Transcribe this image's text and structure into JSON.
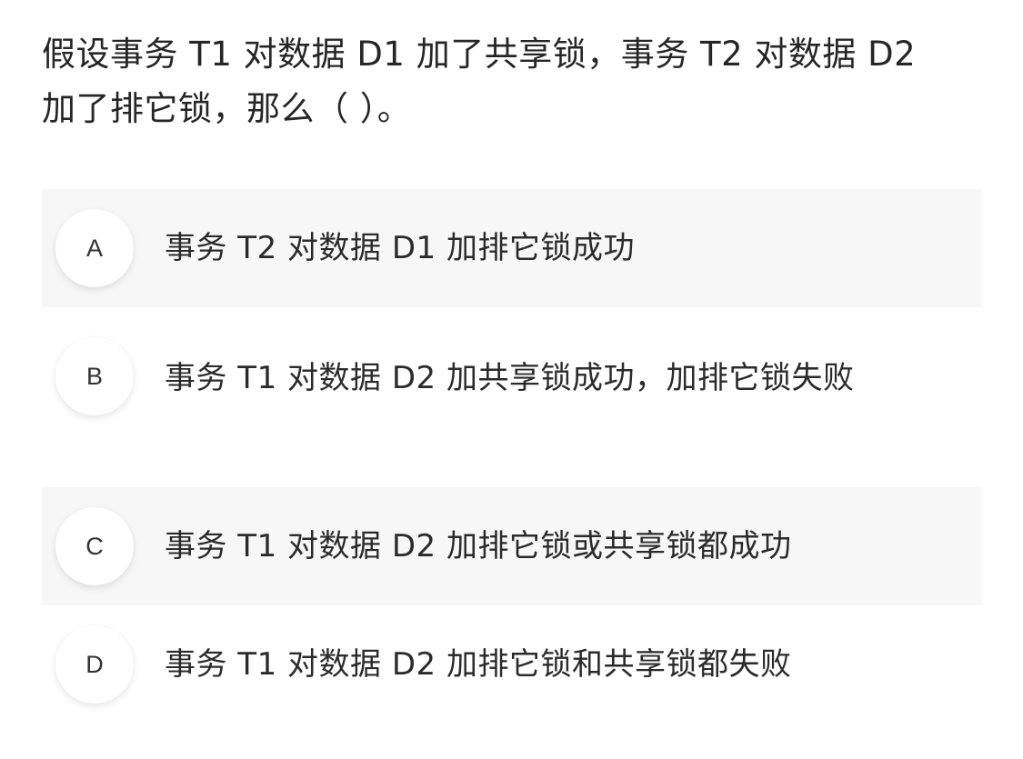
{
  "question": {
    "text": "假设事务 T1 对数据 D1 加了共享锁，事务 T2 对数据 D2 加了排它锁，那么（ ）。"
  },
  "options": [
    {
      "letter": "A",
      "text": "事务 T2 对数据 D1 加排它锁成功"
    },
    {
      "letter": "B",
      "text": "事务 T1 对数据 D2 加共享锁成功，加排它锁失败"
    },
    {
      "letter": "C",
      "text": "事务 T1 对数据 D2 加排它锁或共享锁都成功"
    },
    {
      "letter": "D",
      "text": "事务 T1 对数据 D2 加排它锁和共享锁都失败"
    }
  ],
  "colors": {
    "option_shade": "#f7f7f7",
    "text": "#2b2b2b",
    "circle_bg": "#ffffff"
  }
}
